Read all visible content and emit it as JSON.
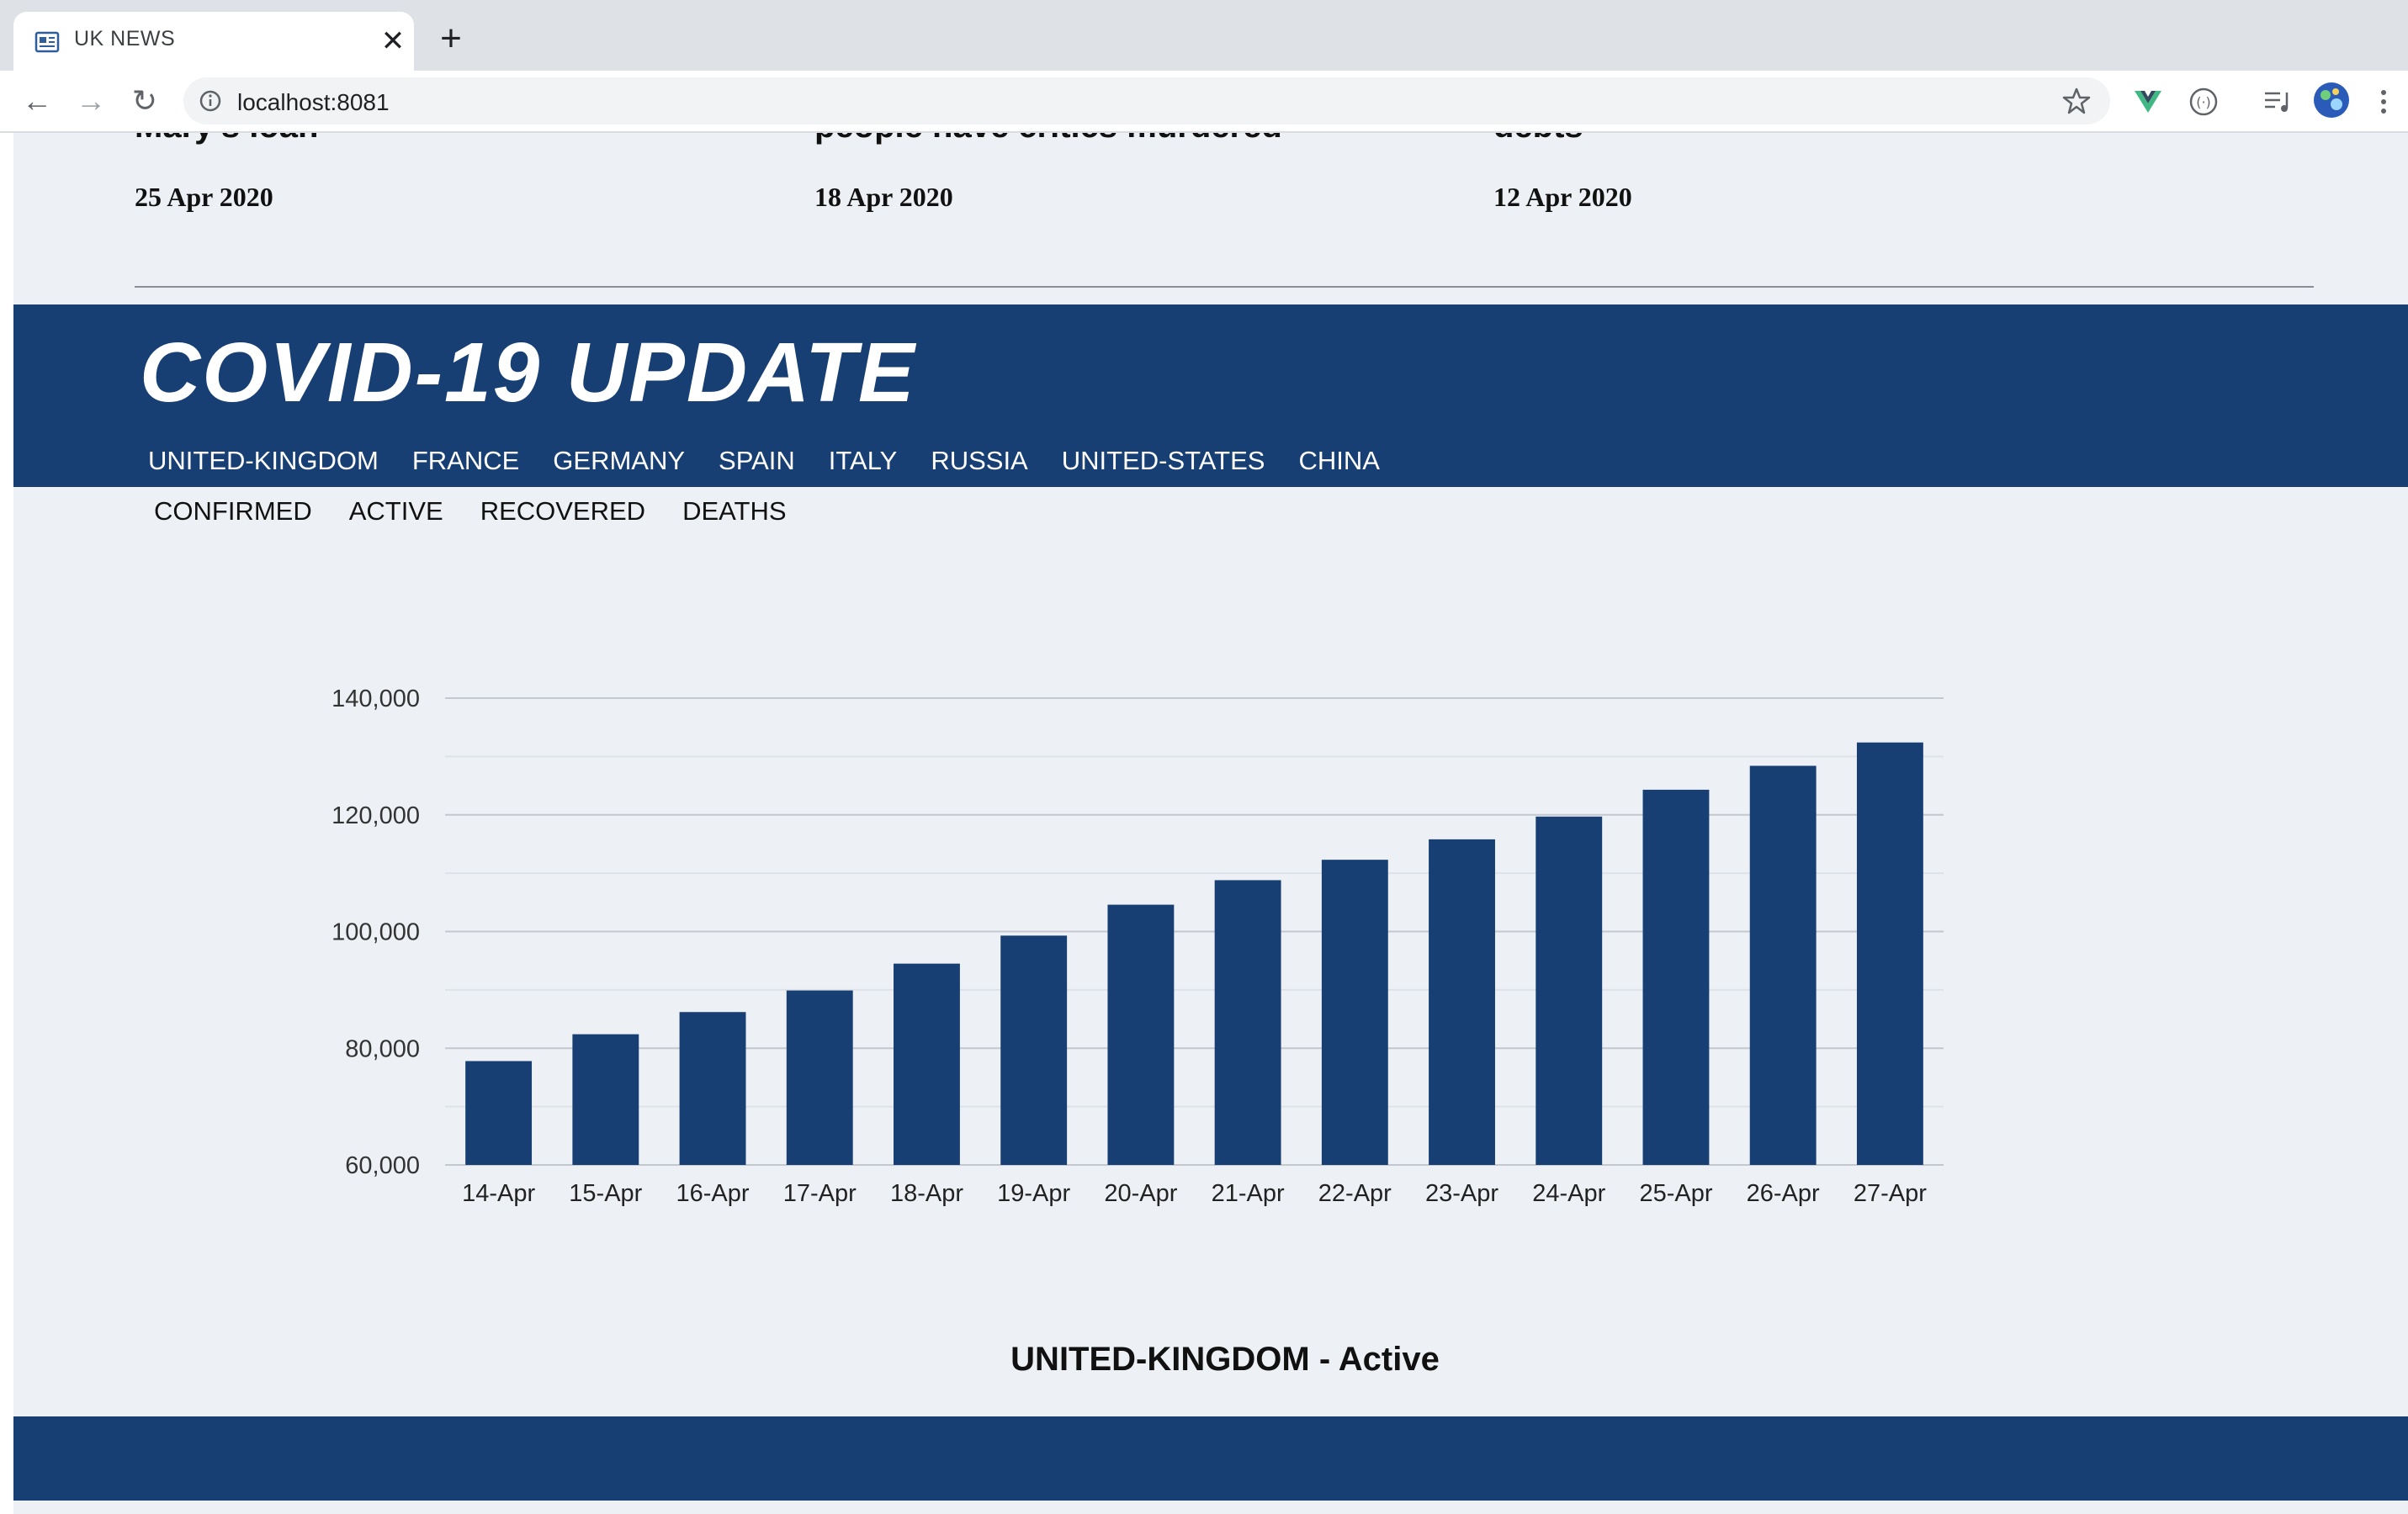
{
  "browser": {
    "tab_title": "UK NEWS",
    "url": "localhost:8081",
    "tab_close": "✕",
    "new_tab": "+",
    "back": "←",
    "forward": "→",
    "reload": "↻"
  },
  "stories": [
    {
      "title": "Mary's loan",
      "date": "25 Apr 2020"
    },
    {
      "title": "people have critics murdered",
      "date": "18 Apr 2020"
    },
    {
      "title": "debts",
      "date": "12 Apr 2020"
    }
  ],
  "covid": {
    "title": "COVID-19 UPDATE",
    "countries": [
      "UNITED-KINGDOM",
      "FRANCE",
      "GERMANY",
      "SPAIN",
      "ITALY",
      "RUSSIA",
      "UNITED-STATES",
      "CHINA"
    ],
    "metrics": [
      "CONFIRMED",
      "ACTIVE",
      "RECOVERED",
      "DEATHS"
    ],
    "caption": "UNITED-KINGDOM - Active"
  },
  "colors": {
    "brand_blue": "#173f73",
    "page_bg": "#edf1f5"
  },
  "chart_data": {
    "type": "bar",
    "categories": [
      "14-Apr",
      "15-Apr",
      "16-Apr",
      "17-Apr",
      "18-Apr",
      "19-Apr",
      "20-Apr",
      "21-Apr",
      "22-Apr",
      "23-Apr",
      "24-Apr",
      "25-Apr",
      "26-Apr",
      "27-Apr"
    ],
    "values": [
      77800,
      82400,
      86200,
      89900,
      94500,
      99300,
      104600,
      108800,
      112300,
      115800,
      119700,
      124300,
      128400,
      132400
    ],
    "ylim": [
      60000,
      140000
    ],
    "yticks": [
      60000,
      80000,
      100000,
      120000,
      140000
    ],
    "ytick_labels": [
      "60,000",
      "80,000",
      "100,000",
      "120,000",
      "140,000"
    ],
    "grid": true,
    "color": "#173f73"
  }
}
